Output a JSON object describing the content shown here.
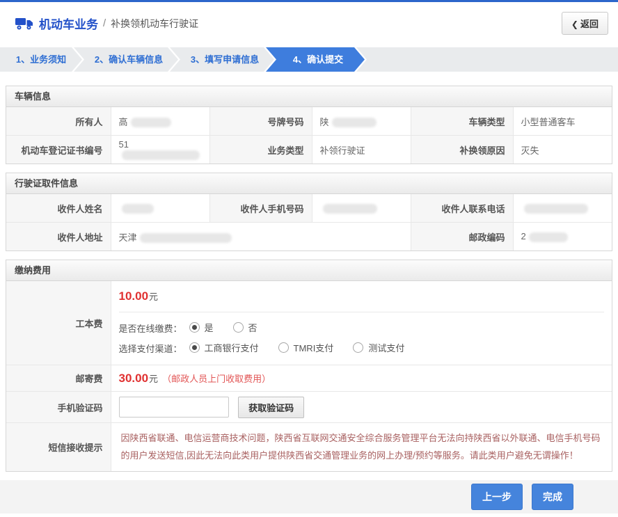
{
  "colors": {
    "brand_blue": "#2351c9",
    "brand_blue_dark": "#2c66cb",
    "step_blue": "#2e6ed3",
    "step_active": "#3e7ddd",
    "red_amount": "#e03131",
    "warn_red": "#a86060",
    "btn_blue": "#4584dc"
  },
  "header": {
    "title": "机动车业务",
    "separator": "/",
    "subtitle": "补换领机动车行驶证",
    "back_icon": "❮",
    "back_label": "返回",
    "truck_icon": "truck-icon"
  },
  "steps": [
    {
      "label": "1、业务须知",
      "active": false
    },
    {
      "label": "2、确认车辆信息",
      "active": false
    },
    {
      "label": "3、填写申请信息",
      "active": false
    },
    {
      "label": "4、确认提交",
      "active": true
    }
  ],
  "vehicle_info": {
    "title": "车辆信息",
    "rows": [
      [
        {
          "label": "所有人",
          "value": "高",
          "redacted": true,
          "redact_w": 58
        },
        {
          "label": "号牌号码",
          "value": "陕",
          "redacted": true,
          "redact_w": 64
        },
        {
          "label": "车辆类型",
          "value": "小型普通客车"
        }
      ],
      [
        {
          "label": "机动车登记证书编号",
          "value": "51",
          "redacted": true,
          "redact_w": 112
        },
        {
          "label": "业务类型",
          "value": "补领行驶证"
        },
        {
          "label": "补换领原因",
          "value": "灭失"
        }
      ]
    ]
  },
  "pickup_info": {
    "title": "行驶证取件信息",
    "rows": [
      [
        {
          "label": "收件人姓名",
          "value": "",
          "redacted": true,
          "redact_w": 46
        },
        {
          "label": "收件人手机号码",
          "value": "",
          "redacted": true,
          "redact_w": 78
        },
        {
          "label": "收件人联系电话",
          "value": "",
          "redacted": true,
          "redact_w": 92
        }
      ],
      [
        {
          "label": "收件人地址",
          "value": "天津",
          "redacted": true,
          "redact_w": 132,
          "span": 3
        },
        {
          "label": "邮政编码",
          "value": "2",
          "redacted": true,
          "redact_w": 56
        }
      ]
    ]
  },
  "fees": {
    "title": "缴纳费用",
    "gongbenfei": {
      "label": "工本费",
      "amount": "10.00",
      "unit": "元",
      "online_label": "是否在线缴费：",
      "online_options": [
        {
          "label": "是",
          "checked": true
        },
        {
          "label": "否",
          "checked": false
        }
      ],
      "channel_label": "选择支付渠道：",
      "channel_options": [
        {
          "label": "工商银行支付",
          "checked": true
        },
        {
          "label": "TMRI支付",
          "checked": false
        },
        {
          "label": "测试支付",
          "checked": false
        }
      ]
    },
    "youjifei": {
      "label": "邮寄费",
      "amount": "30.00",
      "unit": "元",
      "note": "（邮政人员上门收取费用）"
    },
    "captcha": {
      "label": "手机验证码",
      "input_value": "",
      "button": "获取验证码"
    },
    "sms": {
      "label": "短信接收提示",
      "text": "因陕西省联通、电信运营商技术问题，陕西省互联网交通安全综合服务管理平台无法向持陕西省以外联通、电信手机号码的用户发送短信,因此无法向此类用户提供陕西省交通管理业务的网上办理/预约等服务。请此类用户避免无谓操作！"
    }
  },
  "footer": {
    "prev": "上一步",
    "finish": "完成"
  }
}
